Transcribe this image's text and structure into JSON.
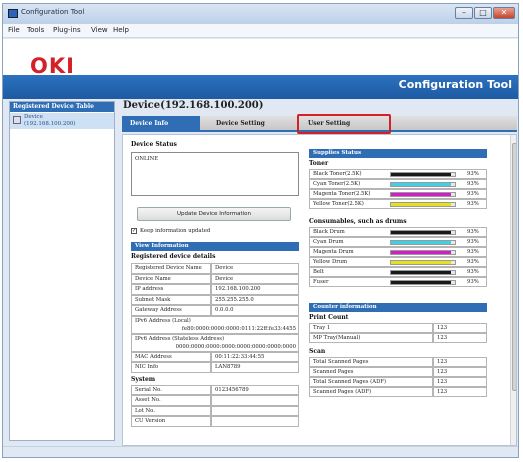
{
  "window": {
    "title": "Configuration Tool"
  },
  "menu": [
    "File",
    "Tools",
    "Plug-ins",
    "View",
    "Help"
  ],
  "brand": {
    "logo": "OKI",
    "app_title": "Configuration Tool"
  },
  "left_pane": {
    "header": "Registered Device Table",
    "device_name": "Device",
    "device_ip": "(192.168.100.200)"
  },
  "device_title": "Device(192.168.100.200)",
  "tabs": [
    {
      "label": "Device Info",
      "active": true
    },
    {
      "label": "Device Setting",
      "active": false
    },
    {
      "label": "User Setting",
      "active": false
    }
  ],
  "device_status": {
    "title": "Device Status",
    "value": "ONLINE",
    "update_button": "Update Device Information",
    "keep_checkbox": "Keep information updated",
    "keep_checked": true
  },
  "view_info": {
    "header": "View Information",
    "registered_title": "Registered device details",
    "rows": [
      {
        "label": "Registered Device Name",
        "value": "Device"
      },
      {
        "label": "Device Name",
        "value": "Device"
      },
      {
        "label": "IP address",
        "value": "192.168.100.200"
      },
      {
        "label": "Subnet Mask",
        "value": "255.255.255.0"
      },
      {
        "label": "Gateway Address",
        "value": "0.0.0.0"
      }
    ],
    "ipv6_local_label": "IPv6 Address (Local)",
    "ipv6_local_value": "fe80:0000:0000:0000:0111:22ff:fe33:4455",
    "ipv6_stateless_label": "IPv6 Address (Stateless Address)",
    "ipv6_stateless_value": "0000:0000:0000:0000:0000:0000:0000:0000",
    "rows2": [
      {
        "label": "MAC Address",
        "value": "00:11:22:33:44:55"
      },
      {
        "label": "NIC Info",
        "value": "LAN8789"
      }
    ],
    "system_title": "System",
    "system_rows": [
      {
        "label": "Serial No.",
        "value": "0123456789"
      },
      {
        "label": "Asset No.",
        "value": ""
      },
      {
        "label": "Lot No.",
        "value": ""
      },
      {
        "label": "CU Version",
        "value": ""
      }
    ]
  },
  "supplies": {
    "header": "Supplies Status",
    "toner_title": "Toner",
    "toner": [
      {
        "label": "Black Toner(2.5K)",
        "percent_text": "93%",
        "level": 93,
        "color": "#1a1a1a"
      },
      {
        "label": "Cyan Toner(2.5K)",
        "percent_text": "93%",
        "level": 93,
        "color": "#3fd0e6"
      },
      {
        "label": "Magenta Toner(2.5K)",
        "percent_text": "93%",
        "level": 93,
        "color": "#d21ec8"
      },
      {
        "label": "Yellow Toner(2.5K)",
        "percent_text": "93%",
        "level": 93,
        "color": "#e6e21a"
      }
    ],
    "consumables_title": "Consumables, such as drums",
    "consumables": [
      {
        "label": "Black Drum",
        "percent_text": "93%",
        "level": 93,
        "color": "#1a1a1a"
      },
      {
        "label": "Cyan Drum",
        "percent_text": "93%",
        "level": 93,
        "color": "#3fd0e6"
      },
      {
        "label": "Magenta Drum",
        "percent_text": "93%",
        "level": 93,
        "color": "#d21ec8"
      },
      {
        "label": "Yellow Drum",
        "percent_text": "93%",
        "level": 93,
        "color": "#e6e21a"
      },
      {
        "label": "Belt",
        "percent_text": "93%",
        "level": 93,
        "color": "#1a1a1a"
      },
      {
        "label": "Fuser",
        "percent_text": "93%",
        "level": 93,
        "color": "#1a1a1a"
      }
    ]
  },
  "counter": {
    "header": "Counter information",
    "print_title": "Print Count",
    "print_rows": [
      {
        "label": "Tray 1",
        "value": "123"
      },
      {
        "label": "MP Tray(Manual)",
        "value": "123"
      }
    ],
    "scan_title": "Scan",
    "scan_rows": [
      {
        "label": "Total Scanned Pages",
        "value": "123"
      },
      {
        "label": "Scanned Pages",
        "value": "123"
      },
      {
        "label": "Total Scanned Pages (ADF)",
        "value": "123"
      },
      {
        "label": "Scanned Pages (ADF)",
        "value": "123"
      }
    ]
  },
  "colors": {
    "accent_blue": "#2f6db5",
    "highlight_red": "#d42127",
    "brand_red": "#d42127"
  }
}
